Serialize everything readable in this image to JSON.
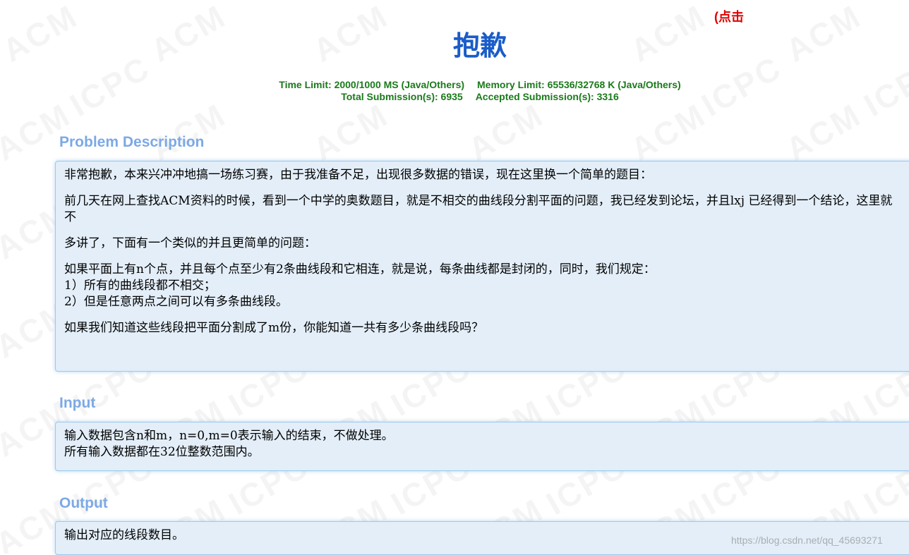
{
  "header": {
    "top_link": "(点击",
    "title": "抱歉",
    "time_limit": "Time Limit: 2000/1000 MS (Java/Others)",
    "memory_limit": "Memory Limit: 65536/32768 K (Java/Others)",
    "total_submissions": "Total Submission(s): 6935",
    "accepted_submissions": "Accepted Submission(s): 3316"
  },
  "watermark": {
    "words": [
      "ACM",
      "ICPC"
    ]
  },
  "sections": {
    "description": {
      "title": "Problem Description",
      "paragraphs": [
        "非常抱歉，本来兴冲冲地搞一场练习赛，由于我准备不足，出现很多数据的错误，现在这里换一个简单的题目：",
        "前几天在网上查找ACM资料的时候，看到一个中学的奥数题目，就是不相交的曲线段分割平面的问题，我已经发到论坛，并且lxj 已经得到一个结论，这里就不",
        "多讲了，下面有一个类似的并且更简单的问题：",
        "如果平面上有n个点，并且每个点至少有2条曲线段和它相连，就是说，每条曲线都是封闭的，同时，我们规定：",
        "1）所有的曲线段都不相交；",
        "2）但是任意两点之间可以有多条曲线段。",
        "如果我们知道这些线段把平面分割成了m份，你能知道一共有多少条曲线段吗？"
      ]
    },
    "input": {
      "title": "Input",
      "lines": [
        "输入数据包含n和m，n=0,m=0表示输入的结束，不做处理。",
        "所有输入数据都在32位整数范围内。"
      ]
    },
    "output": {
      "title": "Output",
      "lines": [
        "输出对应的线段数目。"
      ]
    }
  },
  "footer": {
    "source_watermark": "https://blog.csdn.net/qq_45693271"
  },
  "colors": {
    "title": "#1a5cc8",
    "stats": "#1a7a1a",
    "section_title": "#7ca9e6",
    "panel_bg": "#e3eef8",
    "panel_border": "#9cc9ee",
    "top_link": "#e00000"
  }
}
